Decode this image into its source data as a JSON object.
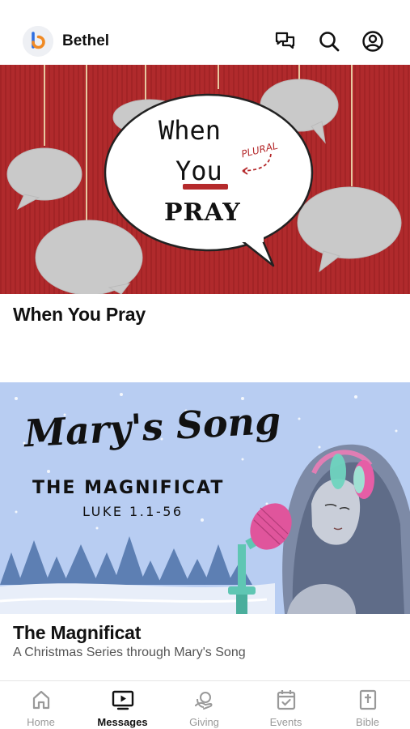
{
  "header": {
    "app_name": "Bethel"
  },
  "messages": [
    {
      "title": "When You Pray",
      "artwork": {
        "line1": "When",
        "line2": "You",
        "annotation": "PLURAL",
        "line3": "PRAY"
      }
    },
    {
      "title": "The Magnificat",
      "subtitle": "A Christmas Series through Mary's Song",
      "artwork": {
        "script_title": "Mary's Song",
        "heading": "THE MAGNIFICAT",
        "reference": "LUKE 1.1-56"
      }
    }
  ],
  "tabs": [
    {
      "label": "Home",
      "icon": "home-icon",
      "active": false
    },
    {
      "label": "Messages",
      "icon": "play-screen-icon",
      "active": true
    },
    {
      "label": "Giving",
      "icon": "giving-icon",
      "active": false
    },
    {
      "label": "Events",
      "icon": "calendar-icon",
      "active": false
    },
    {
      "label": "Bible",
      "icon": "bible-icon",
      "active": false
    }
  ],
  "colors": {
    "accent_blue": "#2f6fe0",
    "accent_orange": "#f08a24",
    "pray_red": "#b52a2c",
    "magnificat_blue": "#b8cdf2"
  }
}
